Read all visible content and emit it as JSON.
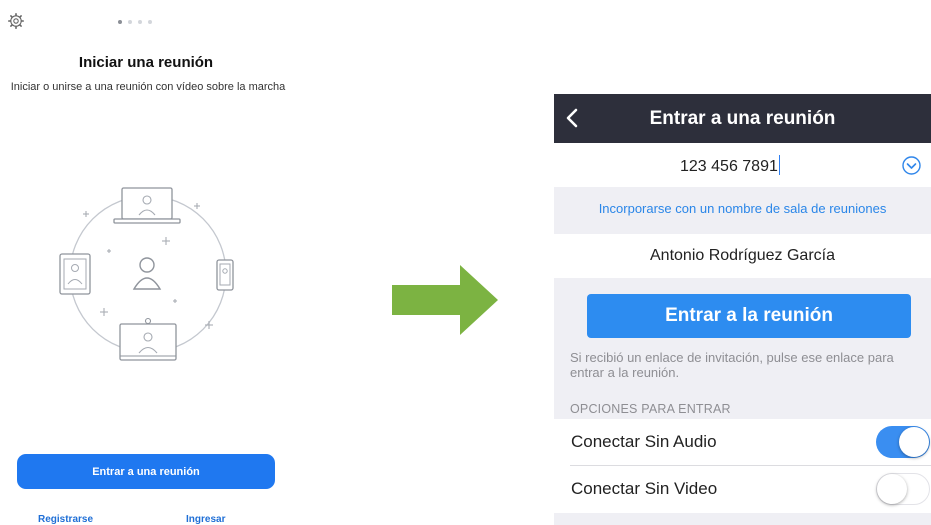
{
  "left_screen": {
    "settings_icon": "gear-icon",
    "page_indicator": {
      "total": 4,
      "active": 1
    },
    "title": "Iniciar una reunión",
    "subtitle": "Iniciar o unirse a una reunión con vídeo sobre la marcha",
    "illustration_icons": [
      "laptop-icon",
      "tablet-icon",
      "user-icon",
      "phone-icon",
      "desktop-icon"
    ],
    "join_button": "Entrar a una reunión",
    "register_link": "Registrarse",
    "login_link": "Ingresar"
  },
  "arrow": {
    "color": "#7cb342",
    "icon": "arrow-right-icon"
  },
  "right_screen": {
    "header": {
      "back_icon": "chevron-left-icon",
      "title": "Entrar a una reunión",
      "color": "#2d2f3b"
    },
    "meeting_id": "123 456 7891",
    "dropdown_icon": "chevron-down-circle-icon",
    "room_name_link": "Incorporarse con un nombre de sala de reuniones",
    "user_name": "Antonio Rodríguez García",
    "join_button": "Entrar a la reunión",
    "hint": "Si recibió un enlace de invitación, pulse ese enlace para entrar a la reunión.",
    "section_title": "OPCIONES PARA ENTRAR",
    "options": [
      {
        "label": "Conectar Sin Audio",
        "enabled": true
      },
      {
        "label": "Conectar Sin Video",
        "enabled": false
      }
    ],
    "accent_color": "#2d8cf0"
  }
}
